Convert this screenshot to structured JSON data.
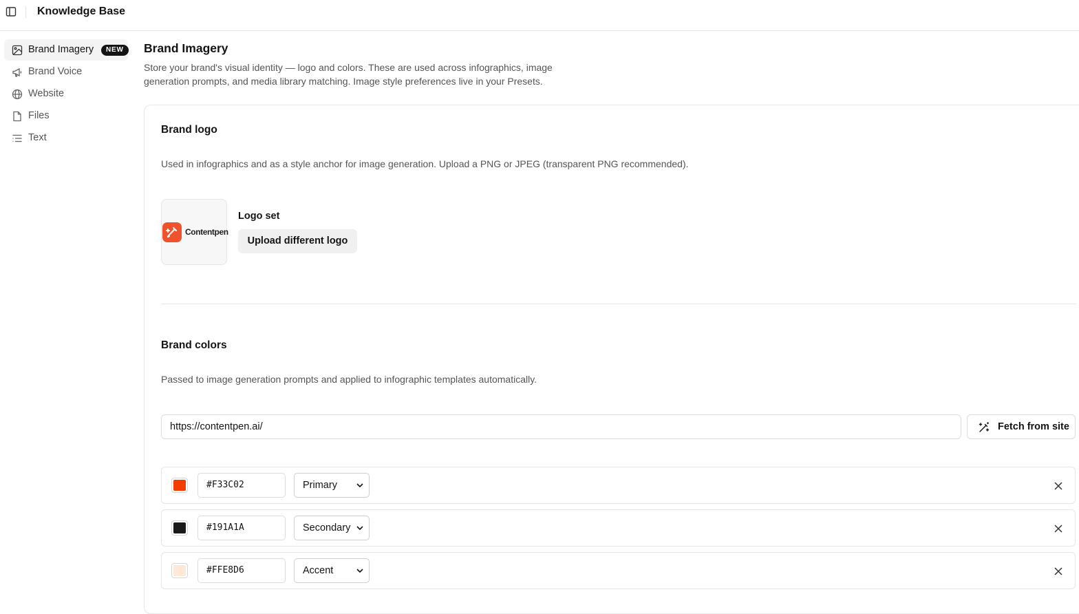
{
  "app": {
    "title": "Knowledge Base"
  },
  "sidebar": {
    "items": [
      {
        "label": "Brand Imagery",
        "icon": "image-icon",
        "badge": "NEW",
        "active": true
      },
      {
        "label": "Brand Voice",
        "icon": "megaphone-icon"
      },
      {
        "label": "Website",
        "icon": "globe-icon"
      },
      {
        "label": "Files",
        "icon": "file-icon"
      },
      {
        "label": "Text",
        "icon": "text-lines-icon"
      }
    ]
  },
  "main": {
    "title": "Brand Imagery",
    "description": "Store your brand's visual identity — logo and colors. These are used across infographics, image generation prompts, and media library matching. Image style preferences live in your Presets."
  },
  "logo_section": {
    "title": "Brand logo",
    "description": "Used in infographics and as a style anchor for image generation. Upload a PNG or JPEG (transparent PNG recommended).",
    "logo_wordmark": "Contentpen",
    "status": "Logo set",
    "upload_button": "Upload different logo"
  },
  "colors_section": {
    "title": "Brand colors",
    "description": "Passed to image generation prompts and applied to infographic templates automatically.",
    "url_value": "https://contentpen.ai/",
    "fetch_button": "Fetch from site",
    "colors": [
      {
        "hex": "#F33C02",
        "role": "Primary"
      },
      {
        "hex": "#191A1A",
        "role": "Secondary"
      },
      {
        "hex": "#FFE8D6",
        "role": "Accent"
      }
    ]
  }
}
